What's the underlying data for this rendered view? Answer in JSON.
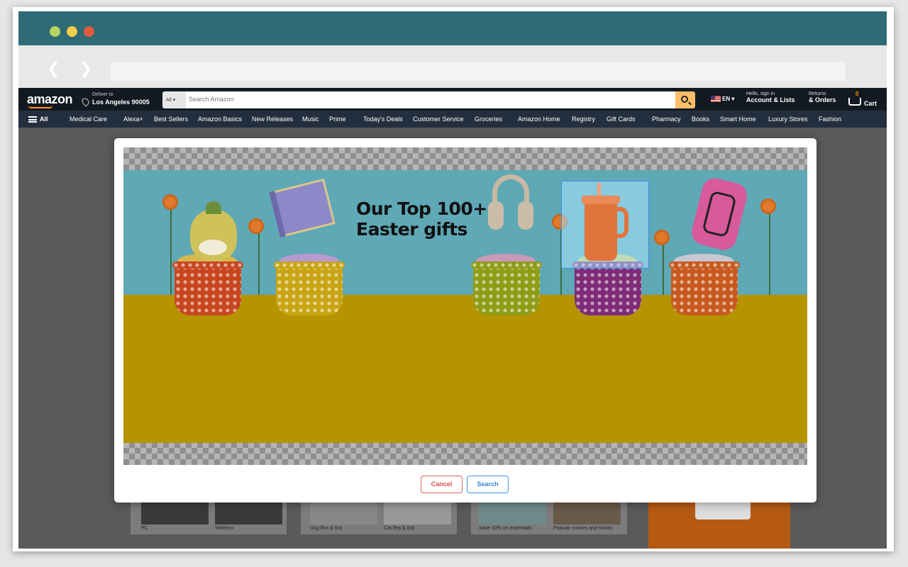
{
  "browser": {
    "back_icon": "chevron-left-icon",
    "forward_icon": "chevron-right-icon",
    "url": ""
  },
  "amazon": {
    "logo": "amazon",
    "deliver_small": "Deliver to",
    "deliver_location": "Los Angeles 90005",
    "search_category": "All",
    "search_placeholder": "Search Amazon",
    "lang": "EN",
    "account_small": "Hello, sign in",
    "account_big": "Account & Lists",
    "returns_small": "Returns",
    "returns_big": "& Orders",
    "cart_count": "0",
    "cart_label": "Cart",
    "nav_all": "All",
    "nav_items": [
      "Medical Care",
      "Alexa+",
      "Best Sellers",
      "Amazon Basics",
      "New Releases",
      "Music",
      "Prime",
      "Today's Deals",
      "Customer Service",
      "Groceries",
      "Amazon Home",
      "Registry",
      "Gift Cards",
      "Pharmacy",
      "Books",
      "Smart Home",
      "Luxury Stores",
      "Fashion"
    ]
  },
  "background_cards": {
    "labels": [
      "PC",
      "Wireless",
      "Dog flea & tick",
      "Cat flea & tick",
      "Save 10% on essentials",
      "Popular movies and shows"
    ]
  },
  "modal": {
    "banner_title_line1": "Our Top 100+",
    "banner_title_line2": "Easter gifts",
    "cancel_label": "Cancel",
    "search_label": "Search"
  }
}
